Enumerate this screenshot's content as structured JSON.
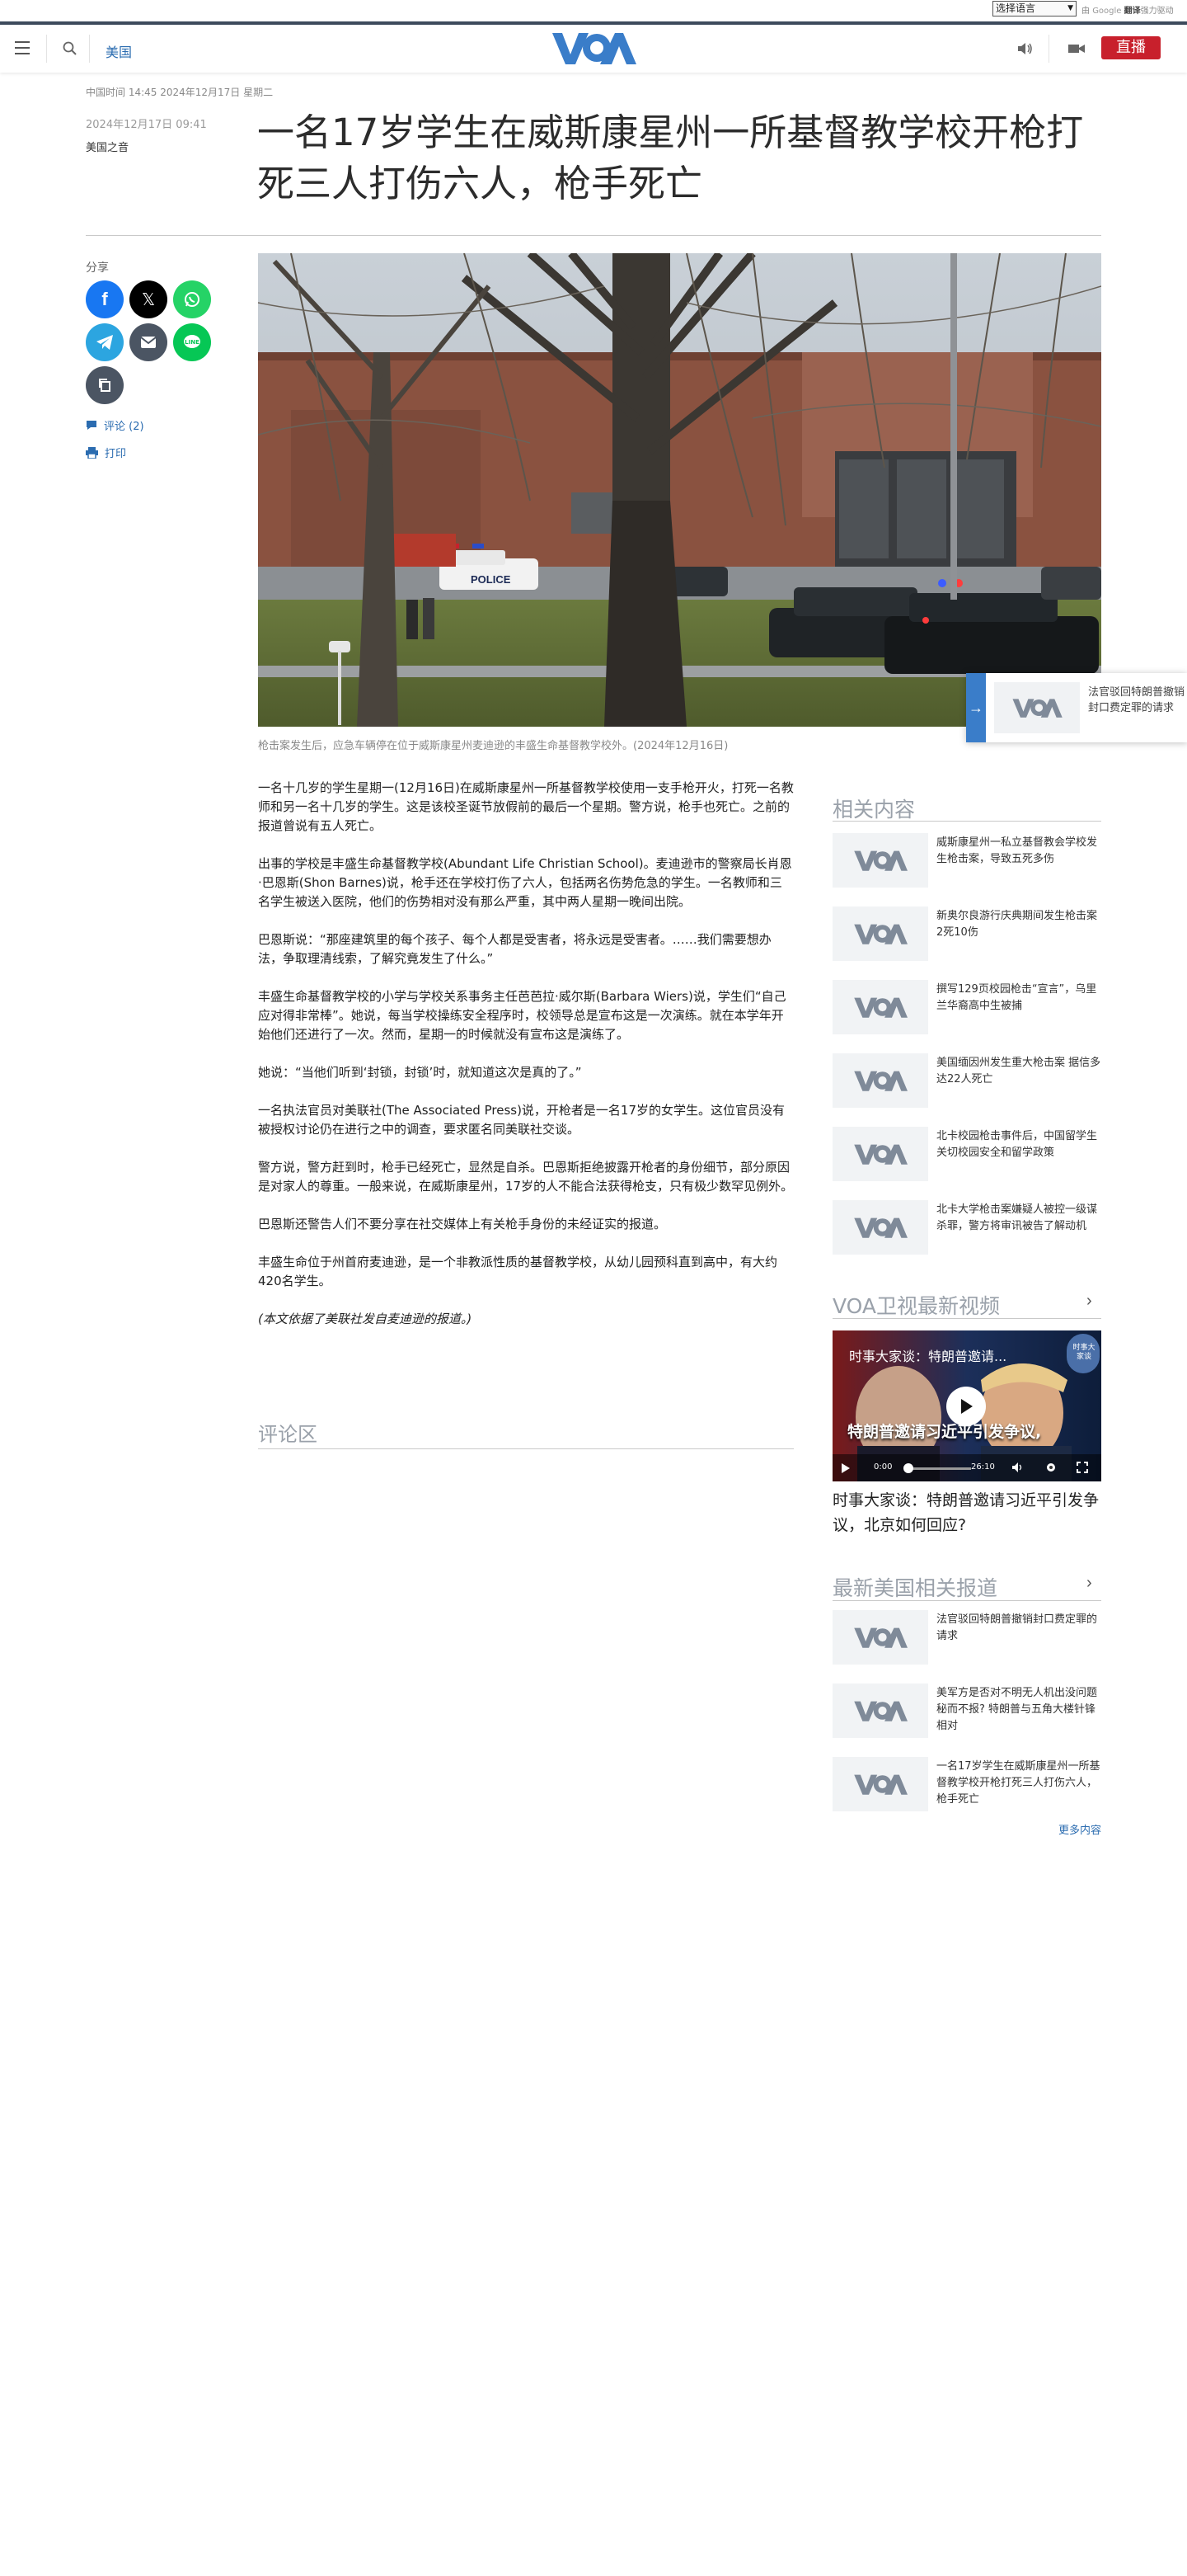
{
  "translate": {
    "select_label": "选择语言",
    "powered_prefix": "由",
    "google": "Google",
    "fanyi": "翻译",
    "powered_suffix": "强力驱动"
  },
  "header": {
    "section": "美国",
    "live_label": "直播"
  },
  "article": {
    "timestamp": "中国时间 14:45 2024年12月17日 星期二",
    "date": "2024年12月17日 09:41",
    "author": "美国之音",
    "title": "一名17岁学生在威斯康星州一所基督教学校开枪打死三人打伤六人，枪手死亡",
    "caption": "枪击案发生后，应急车辆停在位于威斯康星州麦迪逊的丰盛生命基督教学校外。(2024年12月16日)",
    "paragraphs": [
      "一名十几岁的学生星期一(12月16日)在威斯康星州一所基督教学校使用一支手枪开火，打死一名教师和另一名十几岁的学生。这是该校圣诞节放假前的最后一个星期。警方说，枪手也死亡。之前的报道曾说有五人死亡。",
      "出事的学校是丰盛生命基督教学校(Abundant Life Christian School)。麦迪逊市的警察局长肖恩·巴恩斯(Shon Barnes)说，枪手还在学校打伤了六人，包括两名伤势危急的学生。一名教师和三名学生被送入医院，他们的伤势相对没有那么严重，其中两人星期一晚间出院。",
      "巴恩斯说：“那座建筑里的每个孩子、每个人都是受害者，将永远是受害者。……我们需要想办法，争取理清线索，了解究竟发生了什么。”",
      "丰盛生命基督教学校的小学与学校关系事务主任芭芭拉·威尔斯(Barbara Wiers)说，学生们“自己应对得非常棒”。她说，每当学校操练安全程序时，校领导总是宣布这是一次演练。就在本学年开始他们还进行了一次。然而，星期一的时候就没有宣布这是演练了。",
      "她说：“当他们听到‘封锁，封锁’时，就知道这次是真的了。”",
      "一名执法官员对美联社(The Associated Press)说，开枪者是一名17岁的女学生。这位官员没有被授权讨论仍在进行之中的调查，要求匿名同美联社交谈。",
      "警方说，警方赶到时，枪手已经死亡，显然是自杀。巴恩斯拒绝披露开枪者的身份细节，部分原因是对家人的尊重。一般来说，在威斯康星州，17岁的人不能合法获得枪支，只有极少数罕见例外。",
      "巴恩斯还警告人们不要分享在社交媒体上有关枪手身份的未经证实的报道。",
      "丰盛生命位于州首府麦迪逊，是一个非教派性质的基督教学校，从幼儿园预科直到高中，有大约420名学生。"
    ],
    "note": "(本文依据了美联社发自麦迪逊的报道。)"
  },
  "share": {
    "label": "分享",
    "comments": "评论 (2)",
    "print": "打印",
    "icons": [
      "facebook-icon",
      "x-icon",
      "whatsapp-icon",
      "telegram-icon",
      "email-icon",
      "line-icon",
      "copy-link-icon"
    ]
  },
  "floating_card": {
    "text": "法官驳回特朗普撤销封口费定罪的请求"
  },
  "comments_section": {
    "title": "评论区"
  },
  "related": {
    "title": "相关内容",
    "items": [
      "威斯康星州一私立基督教会学校发生枪击案，导致五死多伤",
      "新奥尔良游行庆典期间发生枪击案 2死10伤",
      "撰写129页校园枪击“宣言”，乌里兰华裔高中生被捕",
      "美国缅因州发生重大枪击案 据信多达22人死亡",
      "北卡校园枪击事件后，中国留学生关切校园安全和留学政策",
      "北卡大学枪击案嫌疑人被控一级谋杀罪，警方将审讯被告了解动机"
    ]
  },
  "videos": {
    "title": "VOA卫视最新视频",
    "overlay_title": "时事大家谈：特朗普邀请...",
    "overlay_badge": "时事大家谈",
    "overlay_banner": "特朗普邀请习近平引发争议,",
    "time_current": "0:00",
    "time_total": "26:10",
    "caption": "时事大家谈：特朗普邀请习近平引发争议，北京如何回应?"
  },
  "latest": {
    "title": "最新美国相关报道",
    "items": [
      "法官驳回特朗普撤销封口费定罪的请求",
      "美军方是否对不明无人机出没问题秘而不报? 特朗普与五角大楼针锋相对",
      "一名17岁学生在威斯康星州一所基督教学校开枪打死三人打伤六人，枪手死亡"
    ],
    "more": "更多内容"
  },
  "colors": {
    "brand_blue": "#2b6cb0",
    "live_red": "#c8202c",
    "header_line": "#3d4a5c"
  }
}
